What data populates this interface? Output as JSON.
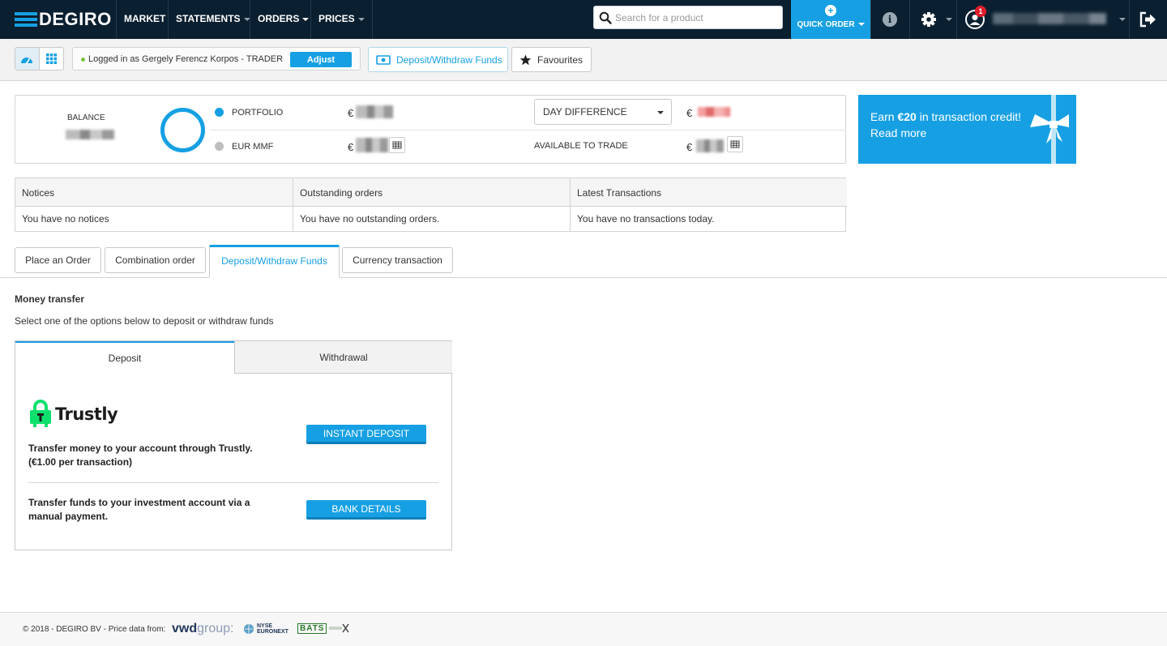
{
  "nav": {
    "logo": "DEGIRO",
    "items": [
      "MARKET",
      "STATEMENTS",
      "ORDERS",
      "PRICES"
    ],
    "search_placeholder": "Search for a product",
    "quick_order": "QUICK ORDER",
    "notification_count": "1"
  },
  "subbar": {
    "login_text": "Logged in as Gergely Ferencz Korpos - TRADER",
    "adjust": "Adjust",
    "deposit_withdraw": "Deposit/Withdraw Funds",
    "favourites": "Favourites"
  },
  "balance": {
    "balance_label": "BALANCE",
    "portfolio_label": "PORTFOLIO",
    "mmf_label": "EUR MMF",
    "currency": "€",
    "day_difference": "DAY DIFFERENCE",
    "available_to_trade": "AVAILABLE TO TRADE",
    "colors": {
      "portfolio": "#16a0e3",
      "mmf": "#bdbdbd"
    }
  },
  "promo": {
    "line1_pre": "Earn ",
    "line1_bold": "€20",
    "line1_post": " in transaction credit!",
    "line2": "Read more"
  },
  "info": {
    "headers": [
      "Notices",
      "Outstanding orders",
      "Latest Transactions"
    ],
    "values": [
      "You have no notices",
      "You have no outstanding orders.",
      "You have no transactions today."
    ]
  },
  "tabs": [
    "Place an Order",
    "Combination order",
    "Deposit/Withdraw Funds",
    "Currency transaction"
  ],
  "money_transfer": {
    "title": "Money transfer",
    "subtitle": "Select one of the options below to deposit or withdraw funds",
    "tab_deposit": "Deposit",
    "tab_withdrawal": "Withdrawal",
    "trustly_name": "Trustly",
    "trustly_desc_1": "Transfer money to your account through Trustly.",
    "trustly_desc_2": "(€1.00 per transaction)",
    "instant_deposit": "INSTANT DEPOSIT",
    "manual_desc_1": "Transfer funds to your investment account via a",
    "manual_desc_2": "manual payment.",
    "bank_details": "BANK DETAILS"
  },
  "footer": {
    "text": "© 2018 - DEGIRO BV - Price data from:",
    "vwd_bold": "vwd",
    "vwd_rest": "group:",
    "nyse_1": "NYSE",
    "nyse_2": "EURONEXT",
    "bats": "BATS"
  },
  "colors": {
    "accent": "#16a0e3",
    "nav_bg": "#0a1f2f"
  }
}
